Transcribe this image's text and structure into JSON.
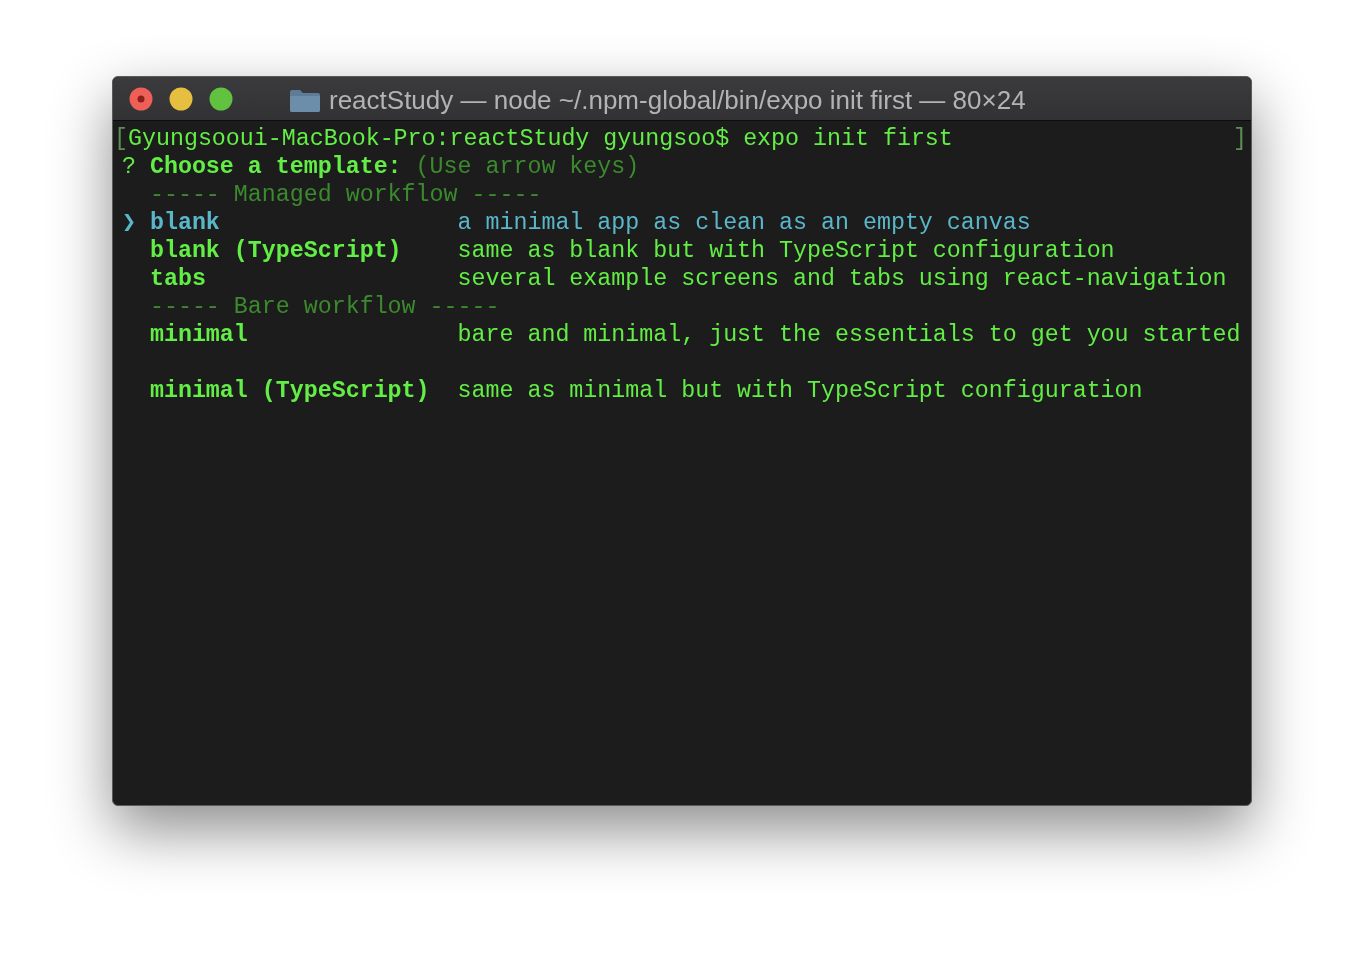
{
  "window": {
    "title": "reactStudy — node ~/.npm-global/bin/expo init first — 80×24",
    "buttons": [
      {
        "kind": "close",
        "color": "#ed5f57"
      },
      {
        "kind": "minimize",
        "color": "#e6bf41"
      },
      {
        "kind": "zoom",
        "color": "#61c23f"
      }
    ]
  },
  "terminal": {
    "pointer": "❯",
    "lines": [
      {
        "kind": "command",
        "open_mark": "[",
        "prompt": "Gyungsooui-MacBook-Pro:reactStudy gyungsoo$",
        "command": "expo init first",
        "close_mark": "]"
      },
      {
        "kind": "question",
        "mark": "?",
        "message": "Choose a template:",
        "hint": "(Use arrow keys)"
      },
      {
        "kind": "separator",
        "text": "----- Managed workflow -----"
      },
      {
        "kind": "choice",
        "label": "blank",
        "description": "a minimal app as clean as an empty canvas",
        "selected": true
      },
      {
        "kind": "choice",
        "label": "blank (TypeScript)",
        "description": "same as blank but with TypeScript configuration",
        "selected": false
      },
      {
        "kind": "choice",
        "label": "tabs",
        "description": "several example screens and tabs using react-navigation",
        "selected": false
      },
      {
        "kind": "separator",
        "text": "----- Bare workflow -----"
      },
      {
        "kind": "choice",
        "label": "minimal",
        "description": "bare and minimal, just the essentials to get you started",
        "selected": false
      },
      {
        "kind": "spacer"
      },
      {
        "kind": "choice",
        "label": "minimal (TypeScript)",
        "description": "same as minimal but with TypeScript configuration",
        "selected": false
      }
    ]
  }
}
